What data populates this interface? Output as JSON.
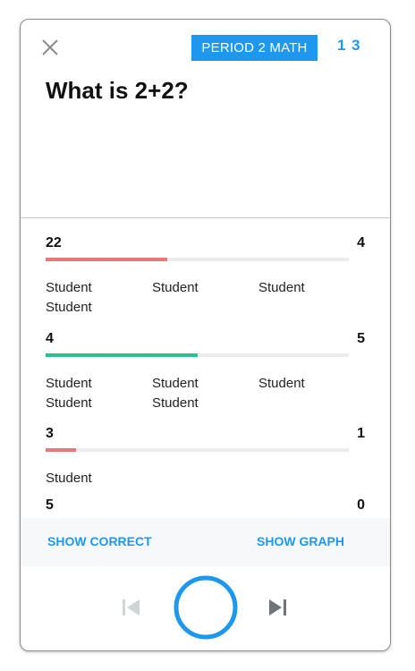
{
  "header": {
    "period_label": "PERIOD 2 MATH",
    "counts": "1 3"
  },
  "question": "What is 2+2?",
  "answers": [
    {
      "count_left": "22",
      "count_right": "4",
      "fill_fraction": 0.4,
      "color": "#e7787a",
      "names": [
        "Student",
        "Student",
        "Student",
        "Student"
      ]
    },
    {
      "count_left": "4",
      "count_right": "5",
      "fill_fraction": 0.5,
      "color": "#25c48b",
      "names": [
        "Student",
        "Student",
        "Student",
        "Student",
        "Student"
      ]
    },
    {
      "count_left": "3",
      "count_right": "1",
      "fill_fraction": 0.1,
      "color": "#e7787a",
      "names": [
        "Student"
      ]
    },
    {
      "count_left": "5",
      "count_right": "0"
    }
  ],
  "actions": {
    "show_correct": "SHOW CORRECT",
    "show_graph": "SHOW GRAPH"
  },
  "icons": {
    "close": "close-icon",
    "prev": "skip-previous-icon",
    "play": "play-circle-icon",
    "next": "skip-next-icon"
  },
  "colors": {
    "accent": "#1e98ee",
    "incorrect": "#e7787a",
    "correct": "#25c48b"
  }
}
